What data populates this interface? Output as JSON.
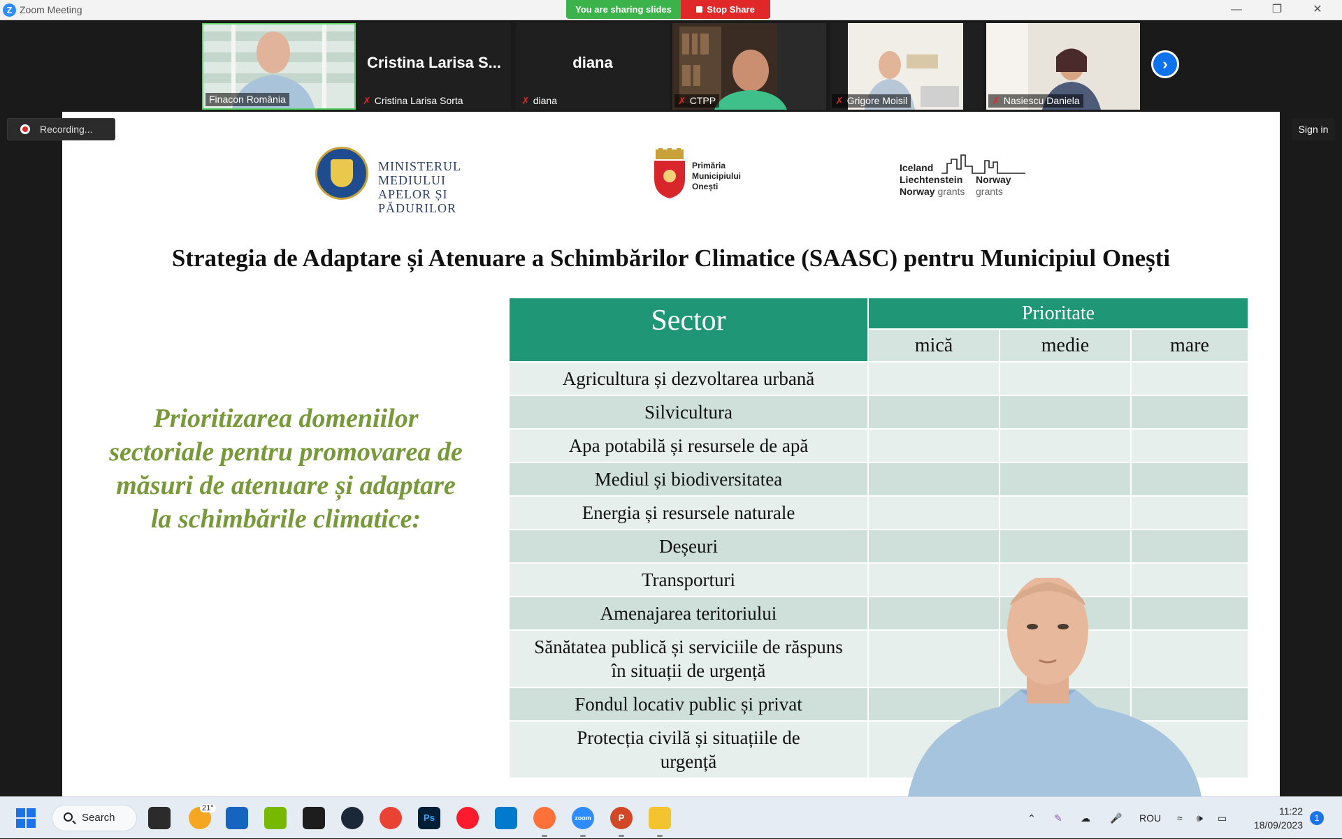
{
  "window": {
    "app_icon": "Z",
    "title": "Zoom Meeting",
    "sharing_status": "You are sharing slides",
    "stop_share_label": "Stop Share",
    "controls": [
      "minimize-icon",
      "restore-icon",
      "close-icon"
    ]
  },
  "participants": [
    {
      "name": "Finacon România",
      "video": true,
      "muted": false
    },
    {
      "name": "Cristina Larisa Sorta",
      "display": "Cristina Larisa S...",
      "video": false,
      "muted": true
    },
    {
      "name": "diana",
      "display": "diana",
      "video": false,
      "muted": true
    },
    {
      "name": "CTPP",
      "video": true,
      "muted": true
    },
    {
      "name": "Grigore Moisil",
      "video": true,
      "muted": true
    },
    {
      "name": "Nasiescu Daniela",
      "video": true,
      "muted": true
    }
  ],
  "recording_label": "Recording...",
  "sign_in_label": "Sign in",
  "slide": {
    "logos": {
      "ministry": [
        "MINISTERUL MEDIULUI",
        "APELOR ȘI PĂDURILOR"
      ],
      "primaria": [
        "Primăria",
        "Municipiului",
        "Onești"
      ],
      "grants": {
        "line1": "Iceland",
        "line2": "Liechtenstein",
        "line3_bold": "Norway",
        "line3_light": "grants",
        "right_bold": "Norway",
        "right_light": "grants"
      }
    },
    "title": "Strategia de Adaptare și Atenuare a Schimbărilor Climatice (SAASC) pentru Municipiul Onești",
    "side_text": "Prioritizarea domeniilor sectoriale pentru promovarea de măsuri de atenuare și adaptare la schimbările climatice:",
    "table": {
      "sector_header": "Sector",
      "priority_header": "Prioritate",
      "priority_levels": [
        "mică",
        "medie",
        "mare"
      ],
      "rows": [
        [
          "Agricultura și dezvoltarea urbană"
        ],
        [
          "Silvicultura"
        ],
        [
          "Apa potabilă și resursele de apă"
        ],
        [
          "Mediul și biodiversitatea"
        ],
        [
          "Energia și resursele naturale"
        ],
        [
          "Deșeuri"
        ],
        [
          "Transporturi"
        ],
        [
          "Amenajarea teritoriului"
        ],
        [
          "Sănătatea publică și serviciile de răspuns",
          "în situații de urgență"
        ],
        [
          "Fondul locativ public și privat"
        ],
        [
          "Protecția civilă și situațiile de",
          "urgență"
        ]
      ]
    }
  },
  "taskbar": {
    "search_label": "Search",
    "weather_temp": "21°",
    "language": "ROU",
    "time": "11:22",
    "date": "18/09/2023",
    "notification_count": "1"
  }
}
